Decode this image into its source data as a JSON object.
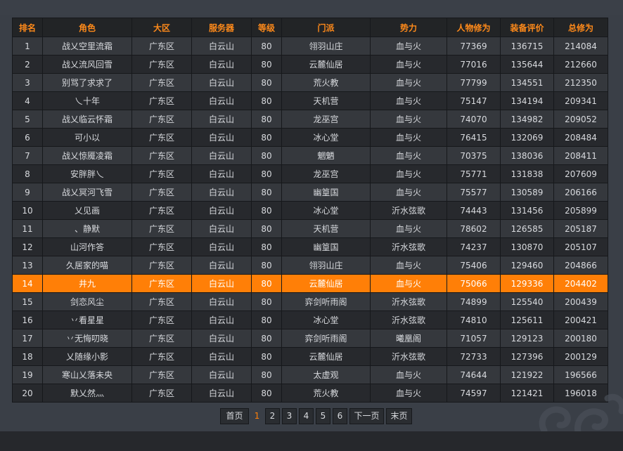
{
  "table": {
    "headers": [
      "排名",
      "角色",
      "大区",
      "服务器",
      "等级",
      "门派",
      "势力",
      "人物修为",
      "装备评价",
      "总修为"
    ],
    "highlight_rank": "14",
    "rows": [
      [
        "1",
        "战乂空里流霜",
        "广东区",
        "白云山",
        "80",
        "翎羽山庄",
        "血与火",
        "77369",
        "136715",
        "214084"
      ],
      [
        "2",
        "战乂流风回雪",
        "广东区",
        "白云山",
        "80",
        "云麓仙居",
        "血与火",
        "77016",
        "135644",
        "212660"
      ],
      [
        "3",
        "别骂了求求了",
        "广东区",
        "白云山",
        "80",
        "荒火教",
        "血与火",
        "77799",
        "134551",
        "212350"
      ],
      [
        "4",
        "乀十年",
        "广东区",
        "白云山",
        "80",
        "天机营",
        "血与火",
        "75147",
        "134194",
        "209341"
      ],
      [
        "5",
        "战乂临云怀霜",
        "广东区",
        "白云山",
        "80",
        "龙巫宫",
        "血与火",
        "74070",
        "134982",
        "209052"
      ],
      [
        "6",
        "可小以",
        "广东区",
        "白云山",
        "80",
        "冰心堂",
        "血与火",
        "76415",
        "132069",
        "208484"
      ],
      [
        "7",
        "战乂惊魇凌霜",
        "广东区",
        "白云山",
        "80",
        "魍魉",
        "血与火",
        "70375",
        "138036",
        "208411"
      ],
      [
        "8",
        "安胖胖乀",
        "广东区",
        "白云山",
        "80",
        "龙巫宫",
        "血与火",
        "75771",
        "131838",
        "207609"
      ],
      [
        "9",
        "战乂冥河飞雪",
        "广东区",
        "白云山",
        "80",
        "幽篁国",
        "血与火",
        "75577",
        "130589",
        "206166"
      ],
      [
        "10",
        "乂见画",
        "广东区",
        "白云山",
        "80",
        "冰心堂",
        "沂水弦歌",
        "74443",
        "131456",
        "205899"
      ],
      [
        "11",
        "、静默",
        "广东区",
        "白云山",
        "80",
        "天机营",
        "血与火",
        "78602",
        "126585",
        "205187"
      ],
      [
        "12",
        "山河作答",
        "广东区",
        "白云山",
        "80",
        "幽篁国",
        "沂水弦歌",
        "74237",
        "130870",
        "205107"
      ],
      [
        "13",
        "久居家的喵",
        "广东区",
        "白云山",
        "80",
        "翎羽山庄",
        "血与火",
        "75406",
        "129460",
        "204866"
      ],
      [
        "14",
        "井九",
        "广东区",
        "白云山",
        "80",
        "云麓仙居",
        "血与火",
        "75066",
        "129336",
        "204402"
      ],
      [
        "15",
        "剑恋风尘",
        "广东区",
        "白云山",
        "80",
        "弈剑听雨阁",
        "沂水弦歌",
        "74899",
        "125540",
        "200439"
      ],
      [
        "16",
        "丷看星星",
        "广东区",
        "白云山",
        "80",
        "冰心堂",
        "沂水弦歌",
        "74810",
        "125611",
        "200421"
      ],
      [
        "17",
        "丷无悔叨晓",
        "广东区",
        "白云山",
        "80",
        "弈剑听雨阁",
        "曦凰阁",
        "71057",
        "129123",
        "200180"
      ],
      [
        "18",
        "乂随缘小影",
        "广东区",
        "白云山",
        "80",
        "云麓仙居",
        "沂水弦歌",
        "72733",
        "127396",
        "200129"
      ],
      [
        "19",
        "寒山乂落未央",
        "广东区",
        "白云山",
        "80",
        "太虚观",
        "血与火",
        "74644",
        "121922",
        "196566"
      ],
      [
        "20",
        "默乂然灬",
        "广东区",
        "白云山",
        "80",
        "荒火教",
        "血与火",
        "74597",
        "121421",
        "196018"
      ]
    ]
  },
  "pager": {
    "first": "首页",
    "pages": [
      "1",
      "2",
      "3",
      "4",
      "5",
      "6"
    ],
    "current": "1",
    "next": "下一页",
    "last": "末页"
  },
  "colors": {
    "accent": "#ff7f07",
    "header_text": "#ff8a1a",
    "row_odd": "#35383d",
    "row_even": "#27292d",
    "text": "#d8dade"
  }
}
